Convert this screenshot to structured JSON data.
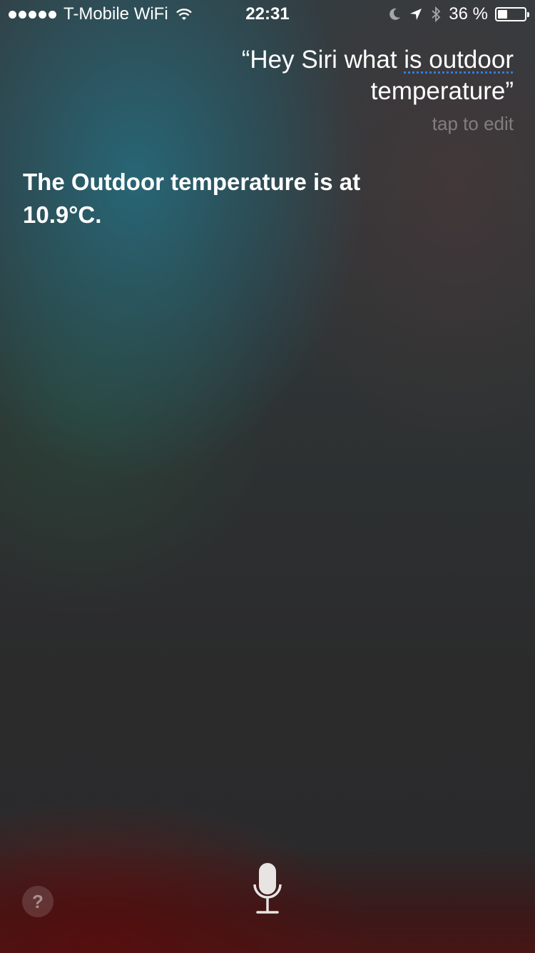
{
  "status_bar": {
    "carrier": "T-Mobile WiFi",
    "time": "22:31",
    "battery_percent_text": "36 %",
    "battery_level": 0.36,
    "icons": [
      "signal-dots-icon",
      "wifi-icon",
      "moon-icon",
      "location-arrow-icon",
      "bluetooth-icon",
      "battery-icon"
    ]
  },
  "query": {
    "open_quote": "“",
    "prefix": "Hey Siri what ",
    "uncertain": "is outdoor",
    "suffix": " temperature",
    "close_quote": "”",
    "tap_to_edit": "tap to edit"
  },
  "response": {
    "text": "The Outdoor temperature is at 10.9°C."
  },
  "controls": {
    "help_label": "?",
    "mic_icon": "microphone-icon"
  },
  "colors": {
    "accent_underline": "#2f7ee8",
    "text": "#ffffff"
  }
}
